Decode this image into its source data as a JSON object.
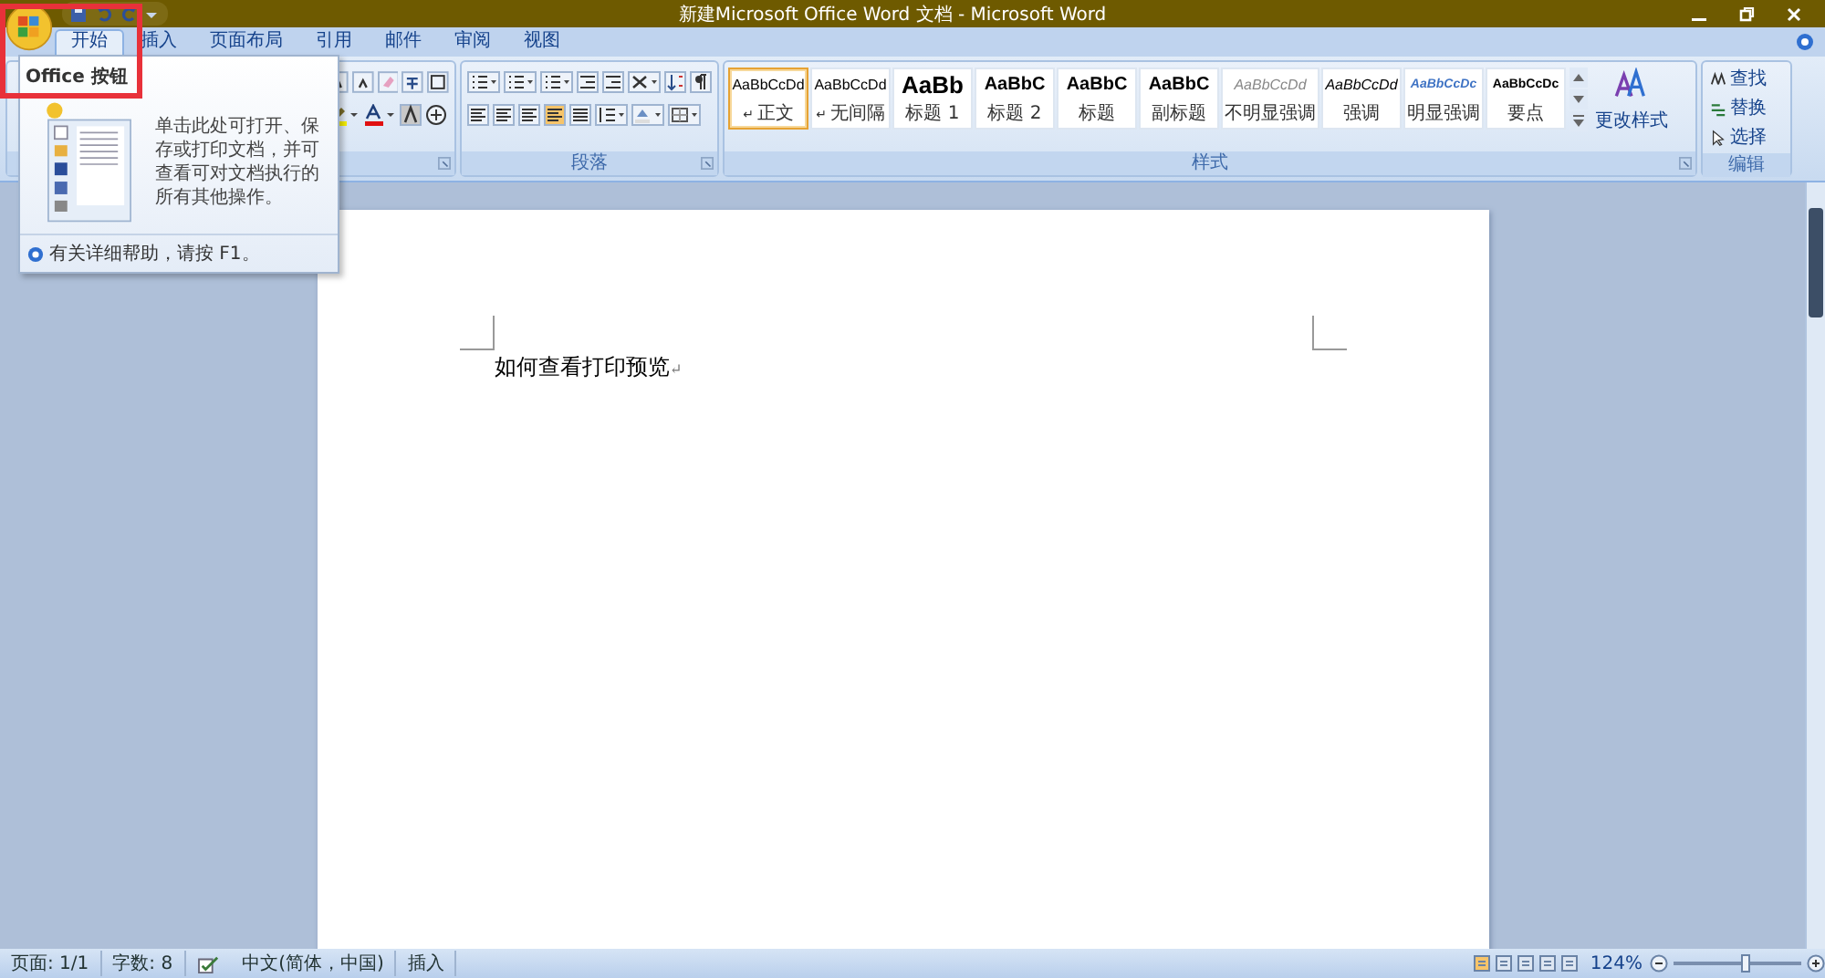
{
  "window": {
    "title": "新建Microsoft Office Word 文档 - Microsoft Word"
  },
  "tabs": [
    {
      "label": "开始",
      "selected": true
    },
    {
      "label": "插入",
      "selected": false
    },
    {
      "label": "页面布局",
      "selected": false
    },
    {
      "label": "引用",
      "selected": false
    },
    {
      "label": "邮件",
      "selected": false
    },
    {
      "label": "审阅",
      "selected": false
    },
    {
      "label": "视图",
      "selected": false
    }
  ],
  "ribbon": {
    "paragraph_group": {
      "label": "段落"
    },
    "styles_group": {
      "label": "样式",
      "styles": [
        {
          "sample": "AaBbCcDd",
          "label": "正文",
          "mark": "↵",
          "kind": "normal",
          "selected": true
        },
        {
          "sample": "AaBbCcDd",
          "label": "无间隔",
          "mark": "↵",
          "kind": "normal",
          "selected": false
        },
        {
          "sample": "AaBb",
          "label": "标题 1",
          "kind": "heading1",
          "selected": false
        },
        {
          "sample": "AaBbC",
          "label": "标题 2",
          "kind": "heading2",
          "selected": false
        },
        {
          "sample": "AaBbC",
          "label": "标题",
          "kind": "title",
          "selected": false
        },
        {
          "sample": "AaBbC",
          "label": "副标题",
          "kind": "subtitle",
          "selected": false
        },
        {
          "sample": "AaBbCcDd",
          "label": "不明显强调",
          "kind": "subtle",
          "selected": false
        },
        {
          "sample": "AaBbCcDd",
          "label": "强调",
          "kind": "emphasis",
          "selected": false
        },
        {
          "sample": "AaBbCcDc",
          "label": "明显强调",
          "kind": "intense",
          "selected": false
        },
        {
          "sample": "AaBbCcDc",
          "label": "要点",
          "kind": "strong",
          "selected": false
        }
      ],
      "change_styles": "更改样式"
    },
    "editing_group": {
      "label": "编辑",
      "items": [
        "查找",
        "替换",
        "选择"
      ]
    }
  },
  "tooltip": {
    "title": "Office 按钮",
    "body": "单击此处可打开、保存或打印文档，并可查看可对文档执行的所有其他操作。",
    "footer": "有关详细帮助，请按 F1。"
  },
  "document": {
    "text": "如何查看打印预览",
    "mark": "↵"
  },
  "status_bar": {
    "page": "页面: 1/1",
    "words": "字数: 8",
    "language": "中文(简体，中国)",
    "mode": "插入",
    "zoom": "124%",
    "zoom_slider": {
      "level": 0.55
    }
  }
}
